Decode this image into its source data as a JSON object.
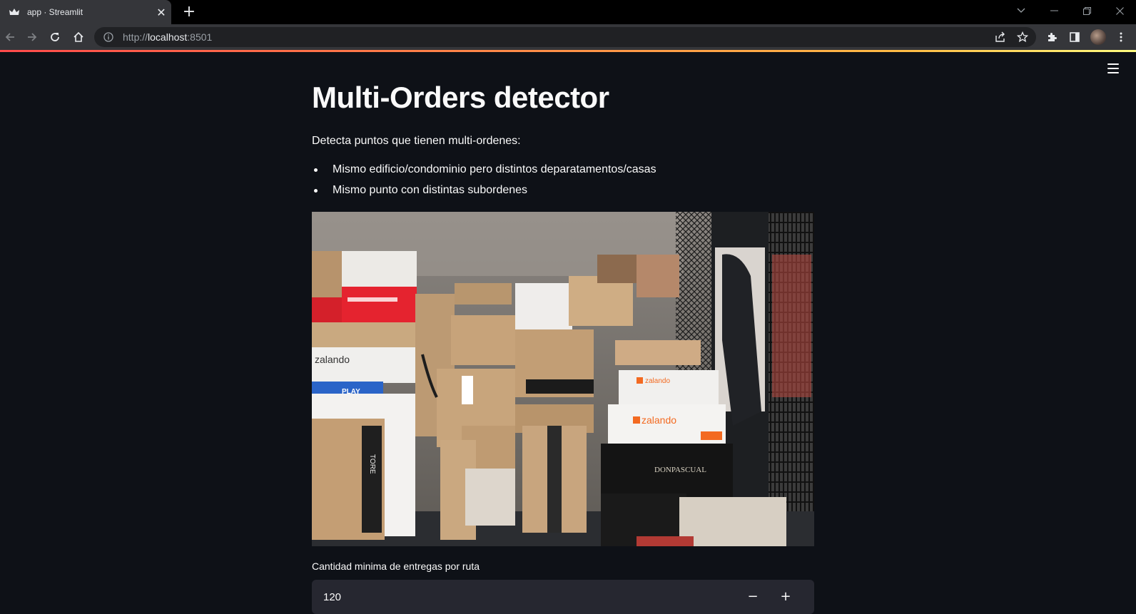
{
  "browser": {
    "tab_title": "app · Streamlit",
    "tab_close": "✕",
    "new_tab": "+",
    "url_scheme": "http://",
    "url_host": "localhost",
    "url_port": ":8501"
  },
  "app": {
    "title": "Multi-Orders detector",
    "description": "Detecta puntos que tienen multi-ordenes:",
    "bullets": [
      "Mismo edificio/condominio pero distintos deparatamentos/casas",
      "Mismo punto con distintas subordenes"
    ],
    "image_texts": {
      "brand_1": "zalando",
      "brand_2": "zalando",
      "brand_3": "zalando",
      "box_play": "PLAY",
      "box_don": "DONPASCUAL",
      "box_tore": "TORE"
    },
    "number_input": {
      "label": "Cantidad minima de entregas por ruta",
      "value": "120",
      "minus": "−",
      "plus": "+"
    }
  },
  "colors": {
    "background": "#0e1117",
    "text": "#fafafa",
    "input_bg": "#262730",
    "accent": "#ff4b4b"
  },
  "icons": [
    "streamlit-crown-icon",
    "back-icon",
    "forward-icon",
    "reload-icon",
    "home-icon",
    "info-icon",
    "share-icon",
    "star-icon",
    "extensions-icon",
    "sidebar-icon",
    "menu-dots-icon",
    "hamburger-icon"
  ]
}
